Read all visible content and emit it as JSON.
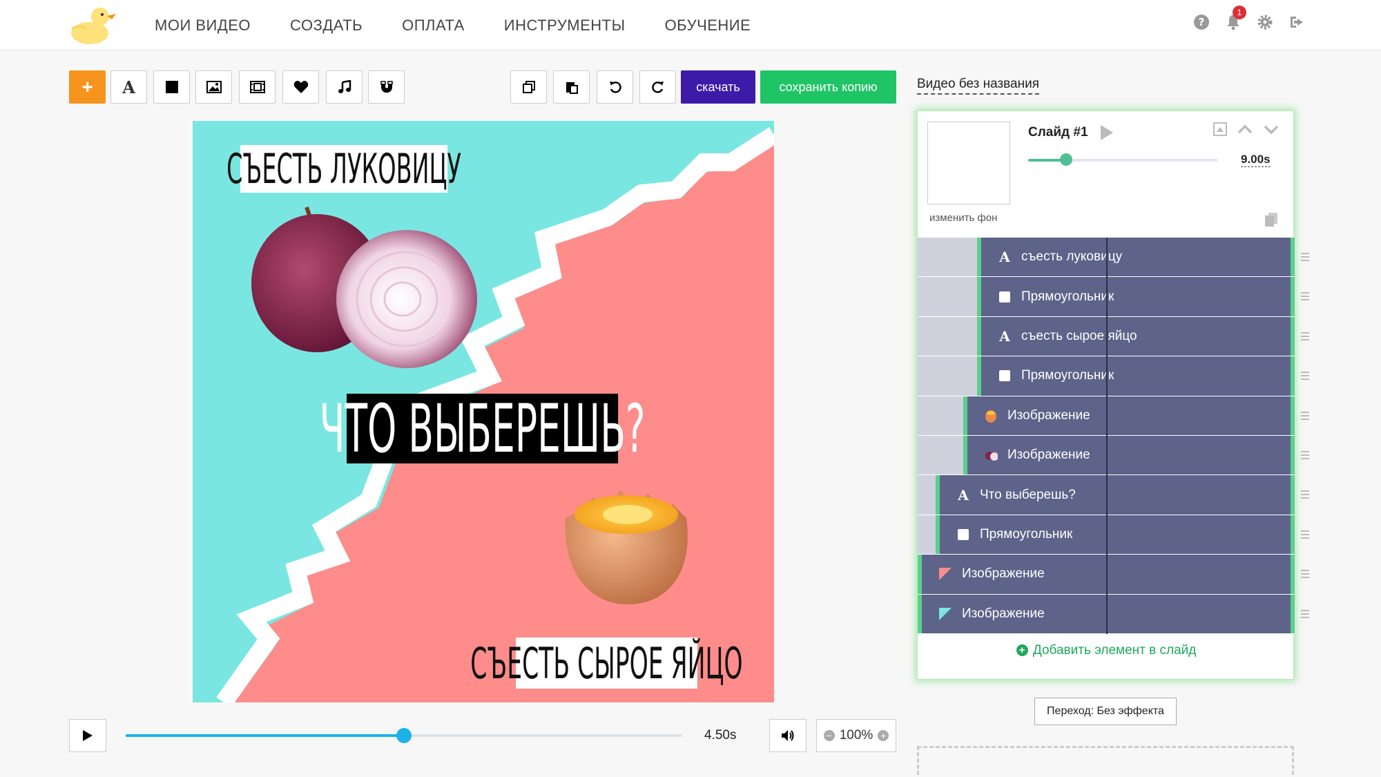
{
  "nav": {
    "items": [
      "Мои видео",
      "Создать",
      "Оплата",
      "Инструменты",
      "Обучение"
    ]
  },
  "header": {
    "notifications_count": "1",
    "icons": [
      "help-icon",
      "bell-icon",
      "gear-icon",
      "logout-icon"
    ]
  },
  "toolbar": {
    "add_label": "+",
    "text_tool_label": "A",
    "download_label": "скачать",
    "save_copy_label": "сохранить копию",
    "icons": [
      "plus-icon",
      "text-icon",
      "square-icon",
      "image-icon",
      "film-icon",
      "heart-icon",
      "music-icon",
      "magnet-icon",
      "copy-icon",
      "paste-icon",
      "undo-icon",
      "redo-icon"
    ]
  },
  "canvas": {
    "caption_top": "Съесть луковицу",
    "caption_middle": "Что выберешь?",
    "caption_bottom": "Съесть сырое яйцо",
    "colors": {
      "teal": "#7ae6e1",
      "pink": "#fd8c8a"
    }
  },
  "player": {
    "time": "4.50s",
    "progress": 0.5,
    "zoom": "100%"
  },
  "panel": {
    "video_title": "Видео без названия",
    "slide_title": "Слайд #1",
    "change_bg": "изменить фон",
    "duration": "9.00s",
    "duration_fraction": 0.2,
    "layers": [
      {
        "label": "съесть луковицу",
        "icon": "text"
      },
      {
        "label": "Прямоугольник",
        "icon": "square"
      },
      {
        "label": "съесть сырое яйцо",
        "icon": "text"
      },
      {
        "label": "Прямоугольник",
        "icon": "square"
      },
      {
        "label": "Изображение",
        "icon": "egg"
      },
      {
        "label": "Изображение",
        "icon": "onion"
      },
      {
        "label": "Что выберешь?",
        "icon": "text"
      },
      {
        "label": "Прямоугольник",
        "icon": "square"
      },
      {
        "label": "Изображение",
        "icon": "pink-triangle"
      },
      {
        "label": "Изображение",
        "icon": "teal-triangle"
      }
    ],
    "add_element": "Добавить элемент в слайд",
    "transition": "Переход: Без эффекта"
  }
}
